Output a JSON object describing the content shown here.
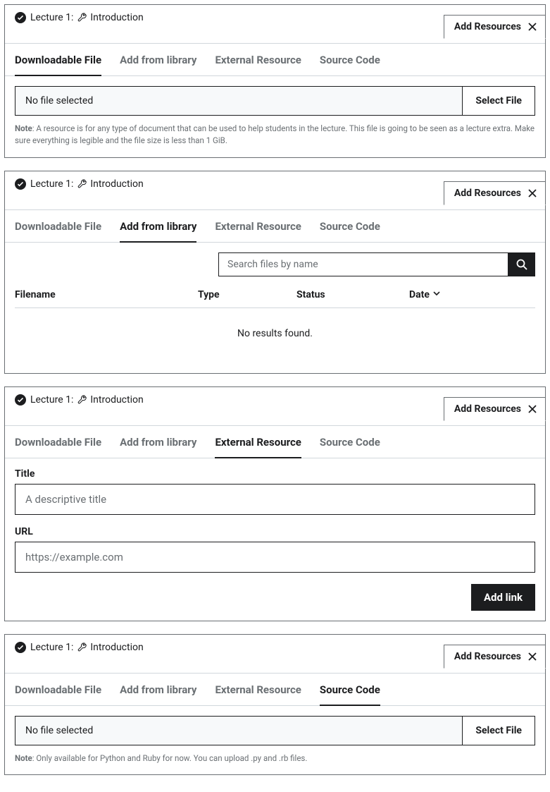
{
  "lecture": {
    "label": "Lecture 1:",
    "title": "Introduction"
  },
  "addResources": "Add Resources",
  "tabs": {
    "downloadable": "Downloadable File",
    "library": "Add from library",
    "external": "External Resource",
    "source": "Source Code"
  },
  "fileSelect": {
    "noFile": "No file selected",
    "button": "Select File"
  },
  "notes": {
    "downloadablePrefix": "Note",
    "downloadable": ": A resource is for any type of document that can be used to help students in the lecture. This file is going to be seen as a lecture extra. Make sure everything is legible and the file size is less than 1 GiB.",
    "sourcePrefix": "Note",
    "source": ": Only available for Python and Ruby for now. You can upload .py and .rb files."
  },
  "library": {
    "searchPlaceholder": "Search files by name",
    "columns": {
      "filename": "Filename",
      "type": "Type",
      "status": "Status",
      "date": "Date"
    },
    "noResults": "No results found."
  },
  "external": {
    "titleLabel": "Title",
    "titlePlaceholder": "A descriptive title",
    "urlLabel": "URL",
    "urlPlaceholder": "https://example.com",
    "addLink": "Add link"
  }
}
